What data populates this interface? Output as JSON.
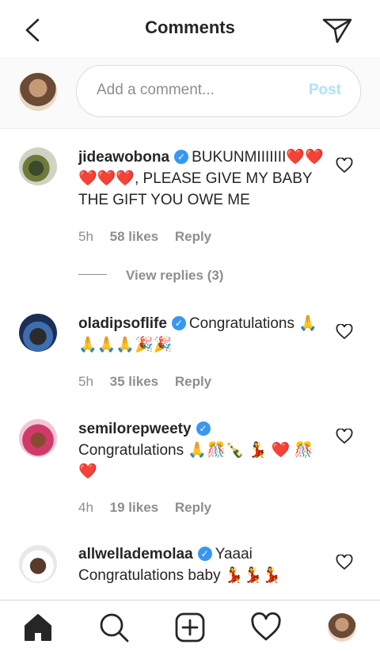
{
  "header": {
    "title": "Comments"
  },
  "composer": {
    "placeholder": "Add a comment...",
    "post_label": "Post"
  },
  "comments": [
    {
      "username": "jideawobona",
      "text": "BUKUNMIIIIIII❤️❤️❤️❤️❤️, PLEASE GIVE MY BABY THE GIFT YOU OWE ME",
      "time": "5h",
      "likes": "58 likes",
      "reply": "Reply",
      "view_replies": "View replies (3)"
    },
    {
      "username": "oladipsoflife",
      "text": "Congratulations 🙏🙏🙏🙏🎉🎉",
      "time": "5h",
      "likes": "35 likes",
      "reply": "Reply"
    },
    {
      "username": "semilorepweety",
      "text": "Congratulations 🙏🎊🍾 💃 ❤️ 🎊❤️",
      "time": "4h",
      "likes": "19 likes",
      "reply": "Reply"
    },
    {
      "username": "allwellademolaa",
      "text": "Yaaai Congratulations baby 💃💃💃"
    }
  ],
  "colors": {
    "verified": "#3897f0",
    "post_disabled": "#b2dffc",
    "muted": "#8e8e8e"
  }
}
